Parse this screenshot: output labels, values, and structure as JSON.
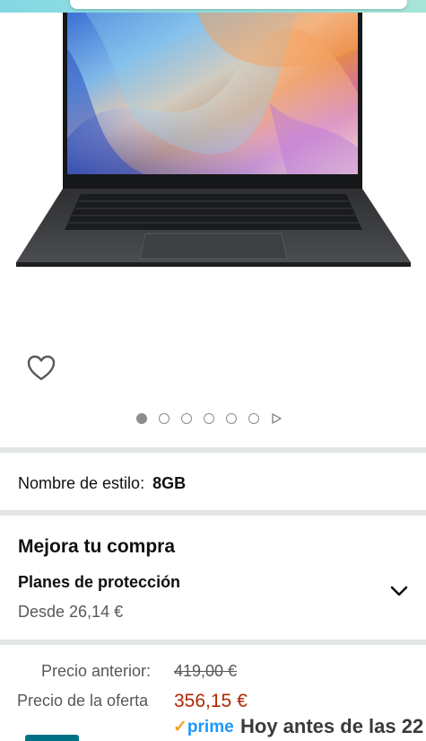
{
  "carousel": {
    "total_images": 6,
    "active_index": 0
  },
  "style": {
    "label": "Nombre de estilo:",
    "value": "8GB"
  },
  "upgrade": {
    "title": "Mejora tu compra",
    "protection_title": "Planes de protección",
    "protection_price": "Desde 26,14 €"
  },
  "pricing": {
    "previous_label": "Precio anterior:",
    "previous_value": "419,00 €",
    "offer_label": "Precio de la oferta",
    "offer_value": "356,15 €"
  },
  "delivery": {
    "prime_check": "✓",
    "prime_label": "prime",
    "text": "Hoy antes de las 22"
  },
  "colors": {
    "offer_price": "#b12704",
    "prime_blue": "#1a98ff",
    "divider": "#e3e6e6"
  },
  "icons": [
    "heart-icon",
    "chevron-down-icon",
    "play-arrow-icon"
  ]
}
